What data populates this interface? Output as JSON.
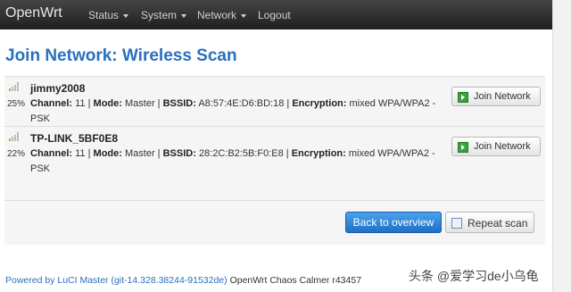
{
  "navbar": {
    "brand": "OpenWrt",
    "items": [
      {
        "label": "Status",
        "has_menu": true
      },
      {
        "label": "System",
        "has_menu": true
      },
      {
        "label": "Network",
        "has_menu": true
      },
      {
        "label": "Logout",
        "has_menu": false
      }
    ]
  },
  "page": {
    "title": "Join Network: Wireless Scan"
  },
  "networks": [
    {
      "signal_percent": "25%",
      "ssid": "jimmy2008",
      "channel_label": "Channel:",
      "channel": "11",
      "mode_label": "Mode:",
      "mode": "Master",
      "bssid_label": "BSSID:",
      "bssid": "A8:57:4E:D6:BD:18",
      "encryption_label": "Encryption:",
      "encryption_line1": "mixed WPA/WPA2 -",
      "encryption_line2": "PSK",
      "join_label": "Join Network"
    },
    {
      "signal_percent": "22%",
      "ssid": "TP-LINK_5BF0E8",
      "channel_label": "Channel:",
      "channel": "11",
      "mode_label": "Mode:",
      "mode": "Master",
      "bssid_label": "BSSID:",
      "bssid": "28:2C:B2:5B:F0:E8",
      "encryption_label": "Encryption:",
      "encryption_line1": "mixed WPA/WPA2 -",
      "encryption_line2": "PSK",
      "join_label": "Join Network"
    }
  ],
  "actions": {
    "back_label": "Back to overview",
    "repeat_label": "Repeat scan"
  },
  "footer": {
    "powered_by": "Powered by LuCI Master (git-14.328.38244-91532de)",
    "version": "OpenWrt Chaos Calmer r43457"
  },
  "watermark": "头条 @爱学习de小乌龟",
  "colors": {
    "accent": "#2a6fbe",
    "navbar": "#2b2b2b",
    "primary_button": "#2f86d8",
    "join_icon": "#3aa23a"
  },
  "icons": [
    "signal-strength-icon",
    "join-network-icon",
    "refresh-icon",
    "caret-down-icon"
  ]
}
